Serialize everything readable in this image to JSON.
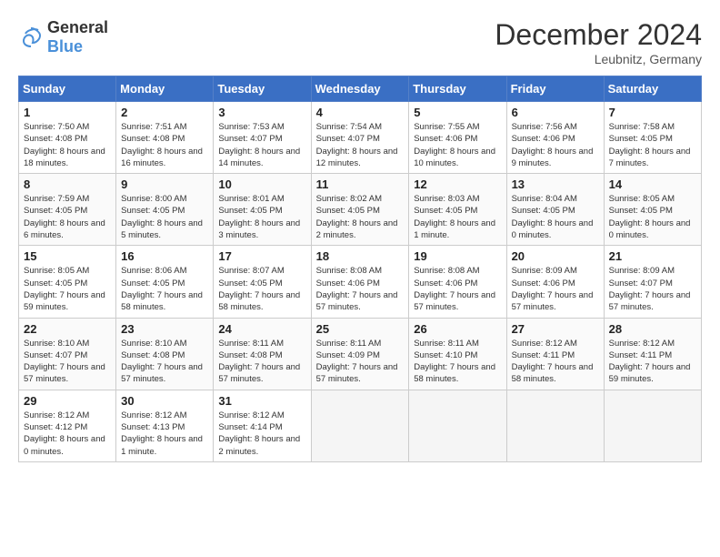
{
  "header": {
    "logo_general": "General",
    "logo_blue": "Blue",
    "month_title": "December 2024",
    "location": "Leubnitz, Germany"
  },
  "days_of_week": [
    "Sunday",
    "Monday",
    "Tuesday",
    "Wednesday",
    "Thursday",
    "Friday",
    "Saturday"
  ],
  "weeks": [
    [
      {
        "day": "1",
        "sunrise": "7:50 AM",
        "sunset": "4:08 PM",
        "daylight": "8 hours and 18 minutes."
      },
      {
        "day": "2",
        "sunrise": "7:51 AM",
        "sunset": "4:08 PM",
        "daylight": "8 hours and 16 minutes."
      },
      {
        "day": "3",
        "sunrise": "7:53 AM",
        "sunset": "4:07 PM",
        "daylight": "8 hours and 14 minutes."
      },
      {
        "day": "4",
        "sunrise": "7:54 AM",
        "sunset": "4:07 PM",
        "daylight": "8 hours and 12 minutes."
      },
      {
        "day": "5",
        "sunrise": "7:55 AM",
        "sunset": "4:06 PM",
        "daylight": "8 hours and 10 minutes."
      },
      {
        "day": "6",
        "sunrise": "7:56 AM",
        "sunset": "4:06 PM",
        "daylight": "8 hours and 9 minutes."
      },
      {
        "day": "7",
        "sunrise": "7:58 AM",
        "sunset": "4:05 PM",
        "daylight": "8 hours and 7 minutes."
      }
    ],
    [
      {
        "day": "8",
        "sunrise": "7:59 AM",
        "sunset": "4:05 PM",
        "daylight": "8 hours and 6 minutes."
      },
      {
        "day": "9",
        "sunrise": "8:00 AM",
        "sunset": "4:05 PM",
        "daylight": "8 hours and 5 minutes."
      },
      {
        "day": "10",
        "sunrise": "8:01 AM",
        "sunset": "4:05 PM",
        "daylight": "8 hours and 3 minutes."
      },
      {
        "day": "11",
        "sunrise": "8:02 AM",
        "sunset": "4:05 PM",
        "daylight": "8 hours and 2 minutes."
      },
      {
        "day": "12",
        "sunrise": "8:03 AM",
        "sunset": "4:05 PM",
        "daylight": "8 hours and 1 minute."
      },
      {
        "day": "13",
        "sunrise": "8:04 AM",
        "sunset": "4:05 PM",
        "daylight": "8 hours and 0 minutes."
      },
      {
        "day": "14",
        "sunrise": "8:05 AM",
        "sunset": "4:05 PM",
        "daylight": "8 hours and 0 minutes."
      }
    ],
    [
      {
        "day": "15",
        "sunrise": "8:05 AM",
        "sunset": "4:05 PM",
        "daylight": "7 hours and 59 minutes."
      },
      {
        "day": "16",
        "sunrise": "8:06 AM",
        "sunset": "4:05 PM",
        "daylight": "7 hours and 58 minutes."
      },
      {
        "day": "17",
        "sunrise": "8:07 AM",
        "sunset": "4:05 PM",
        "daylight": "7 hours and 58 minutes."
      },
      {
        "day": "18",
        "sunrise": "8:08 AM",
        "sunset": "4:06 PM",
        "daylight": "7 hours and 57 minutes."
      },
      {
        "day": "19",
        "sunrise": "8:08 AM",
        "sunset": "4:06 PM",
        "daylight": "7 hours and 57 minutes."
      },
      {
        "day": "20",
        "sunrise": "8:09 AM",
        "sunset": "4:06 PM",
        "daylight": "7 hours and 57 minutes."
      },
      {
        "day": "21",
        "sunrise": "8:09 AM",
        "sunset": "4:07 PM",
        "daylight": "7 hours and 57 minutes."
      }
    ],
    [
      {
        "day": "22",
        "sunrise": "8:10 AM",
        "sunset": "4:07 PM",
        "daylight": "7 hours and 57 minutes."
      },
      {
        "day": "23",
        "sunrise": "8:10 AM",
        "sunset": "4:08 PM",
        "daylight": "7 hours and 57 minutes."
      },
      {
        "day": "24",
        "sunrise": "8:11 AM",
        "sunset": "4:08 PM",
        "daylight": "7 hours and 57 minutes."
      },
      {
        "day": "25",
        "sunrise": "8:11 AM",
        "sunset": "4:09 PM",
        "daylight": "7 hours and 57 minutes."
      },
      {
        "day": "26",
        "sunrise": "8:11 AM",
        "sunset": "4:10 PM",
        "daylight": "7 hours and 58 minutes."
      },
      {
        "day": "27",
        "sunrise": "8:12 AM",
        "sunset": "4:11 PM",
        "daylight": "7 hours and 58 minutes."
      },
      {
        "day": "28",
        "sunrise": "8:12 AM",
        "sunset": "4:11 PM",
        "daylight": "7 hours and 59 minutes."
      }
    ],
    [
      {
        "day": "29",
        "sunrise": "8:12 AM",
        "sunset": "4:12 PM",
        "daylight": "8 hours and 0 minutes."
      },
      {
        "day": "30",
        "sunrise": "8:12 AM",
        "sunset": "4:13 PM",
        "daylight": "8 hours and 1 minute."
      },
      {
        "day": "31",
        "sunrise": "8:12 AM",
        "sunset": "4:14 PM",
        "daylight": "8 hours and 2 minutes."
      },
      null,
      null,
      null,
      null
    ]
  ]
}
